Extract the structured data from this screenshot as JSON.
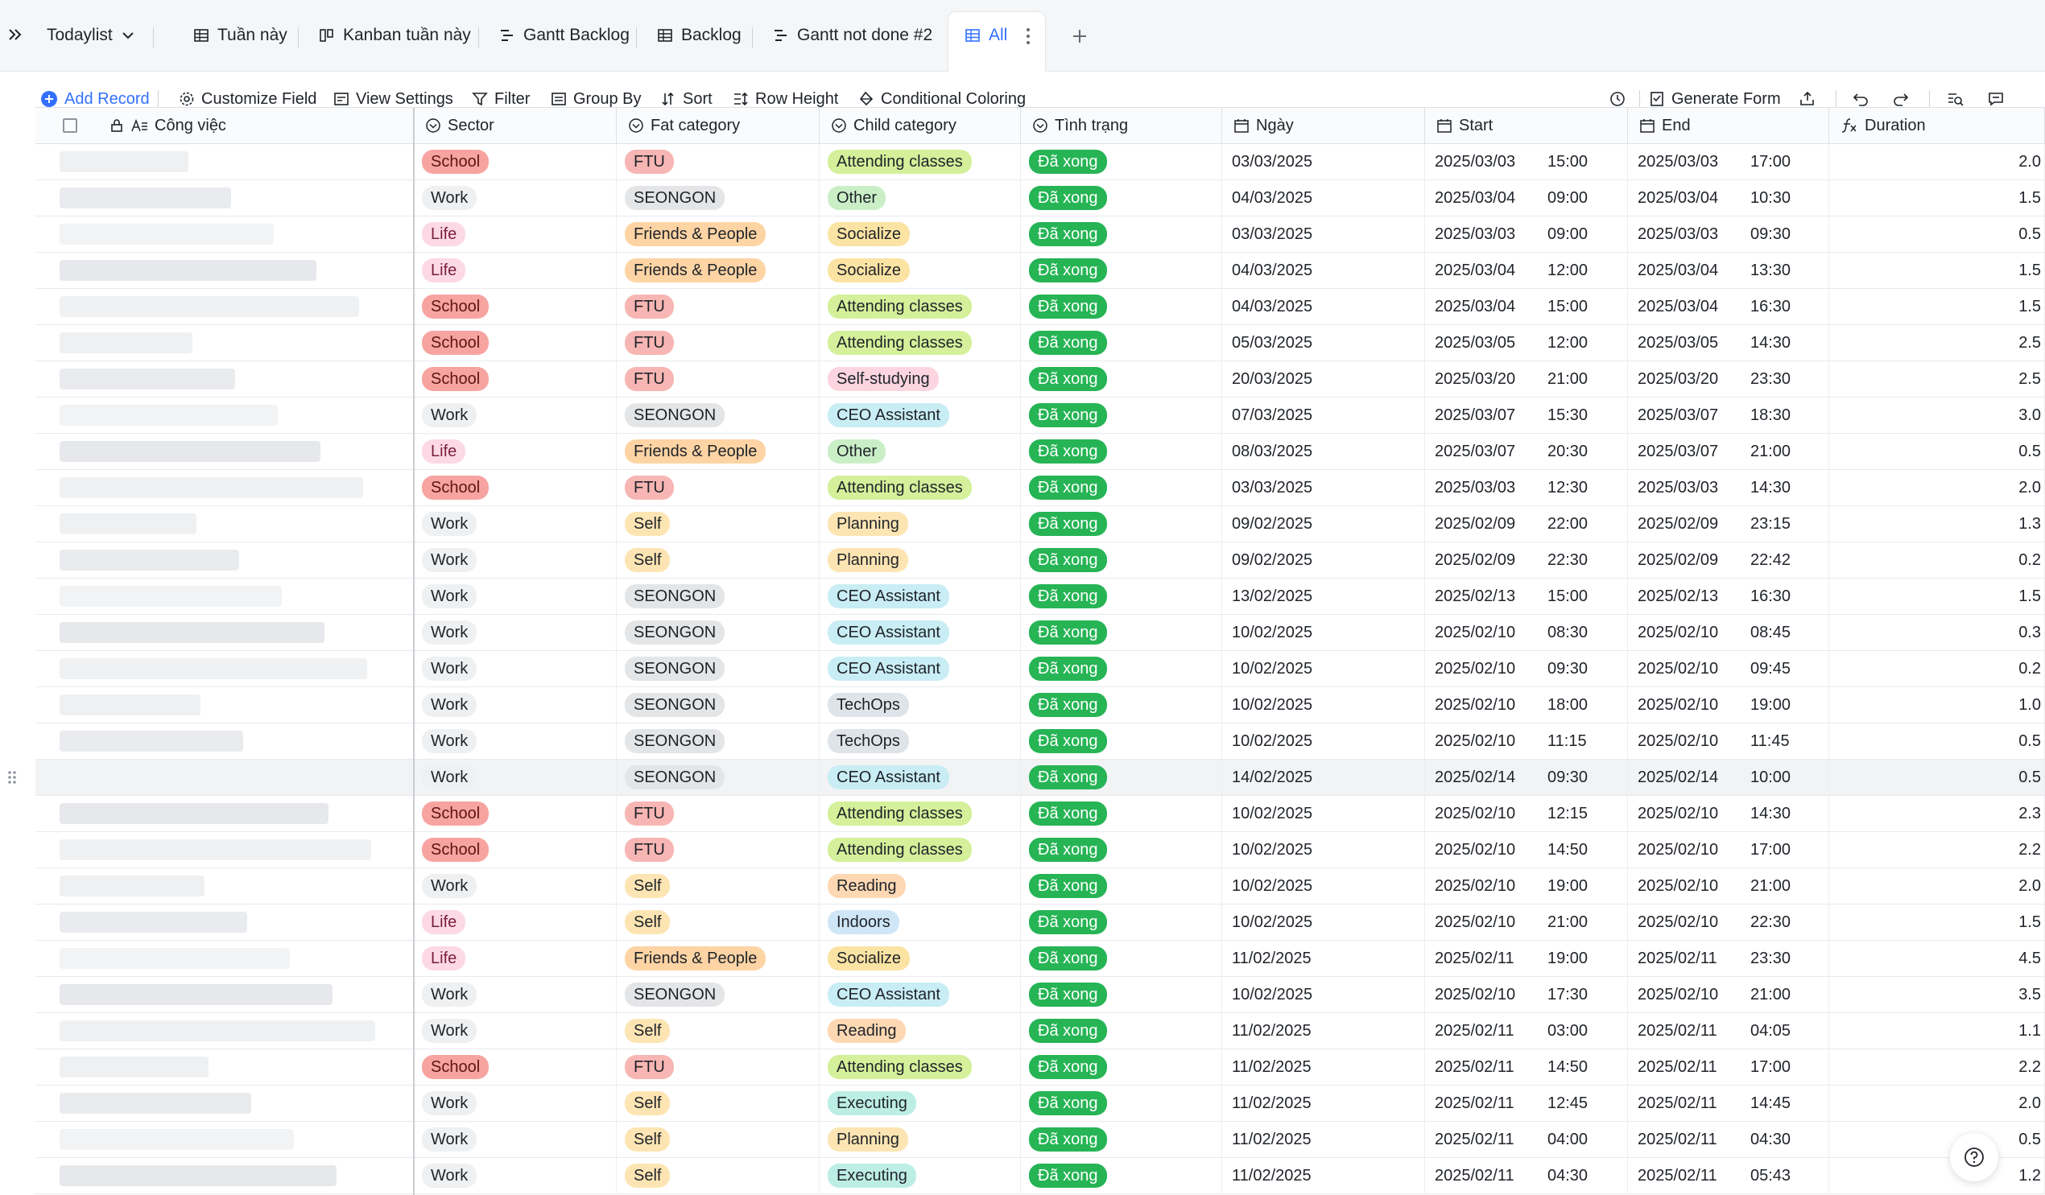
{
  "tabbar": {
    "base_name": "Todaylist",
    "tabs": [
      {
        "label": "Tuần này",
        "icon": "grid-icon"
      },
      {
        "label": "Kanban tuần này",
        "icon": "kanban-icon"
      },
      {
        "label": "Gantt Backlog",
        "icon": "gantt-icon"
      },
      {
        "label": "Backlog",
        "icon": "grid-icon"
      },
      {
        "label": "Gantt not done #2",
        "icon": "gantt-icon"
      },
      {
        "label": "All",
        "icon": "grid-icon",
        "active": true
      }
    ]
  },
  "toolbar": {
    "add_record": "Add Record",
    "customize_field": "Customize Field",
    "view_settings": "View Settings",
    "filter": "Filter",
    "group_by": "Group By",
    "sort": "Sort",
    "row_height": "Row Height",
    "conditional_coloring": "Conditional Coloring",
    "generate_form": "Generate Form"
  },
  "columns": {
    "name": "Công việc",
    "sector": "Sector",
    "fat": "Fat category",
    "child": "Child category",
    "status": "Tình trạng",
    "date": "Ngày",
    "start": "Start",
    "end": "End",
    "duration": "Duration"
  },
  "colors": {
    "accent": "#3370ff",
    "school_bg": "#f7a4a1",
    "school_fg": "#5c1511",
    "work_bg": "#eff0f1",
    "work_fg": "#1f2329",
    "life_bg": "#fcd9e4",
    "life_fg": "#7a1e3e",
    "ftu_bg": "#f7b6b3",
    "seongon_bg": "#e4e5e7",
    "friends_bg": "#fed4a4",
    "self_bg": "#fde5b3",
    "attending_bg": "#d4f09a",
    "other_bg": "#caefc7",
    "socialize_bg": "#fbe3a3",
    "selfstudy_bg": "#fcd5e0",
    "ceo_bg": "#c9edf4",
    "planning_bg": "#fde5b3",
    "techops_bg": "#dfe4ea",
    "reading_bg": "#fdd8b3",
    "indoors_bg": "#cfe6f7",
    "executing_bg": "#bdeee6",
    "status_bg": "#26b455"
  },
  "rows": [
    {
      "sector": "School",
      "fat": "FTU",
      "child": "Attending classes",
      "status": "Đã xong",
      "date": "03/03/2025",
      "start_d": "2025/03/03",
      "start_t": "15:00",
      "end_d": "2025/03/03",
      "end_t": "17:00",
      "dur": "2.0"
    },
    {
      "sector": "Work",
      "fat": "SEONGON",
      "child": "Other",
      "status": "Đã xong",
      "date": "04/03/2025",
      "start_d": "2025/03/04",
      "start_t": "09:00",
      "end_d": "2025/03/04",
      "end_t": "10:30",
      "dur": "1.5"
    },
    {
      "sector": "Life",
      "fat": "Friends & People",
      "child": "Socialize",
      "status": "Đã xong",
      "date": "03/03/2025",
      "start_d": "2025/03/03",
      "start_t": "09:00",
      "end_d": "2025/03/03",
      "end_t": "09:30",
      "dur": "0.5"
    },
    {
      "sector": "Life",
      "fat": "Friends & People",
      "child": "Socialize",
      "status": "Đã xong",
      "date": "04/03/2025",
      "start_d": "2025/03/04",
      "start_t": "12:00",
      "end_d": "2025/03/04",
      "end_t": "13:30",
      "dur": "1.5"
    },
    {
      "sector": "School",
      "fat": "FTU",
      "child": "Attending classes",
      "status": "Đã xong",
      "date": "04/03/2025",
      "start_d": "2025/03/04",
      "start_t": "15:00",
      "end_d": "2025/03/04",
      "end_t": "16:30",
      "dur": "1.5"
    },
    {
      "sector": "School",
      "fat": "FTU",
      "child": "Attending classes",
      "status": "Đã xong",
      "date": "05/03/2025",
      "start_d": "2025/03/05",
      "start_t": "12:00",
      "end_d": "2025/03/05",
      "end_t": "14:30",
      "dur": "2.5"
    },
    {
      "sector": "School",
      "fat": "FTU",
      "child": "Self-studying",
      "status": "Đã xong",
      "date": "20/03/2025",
      "start_d": "2025/03/20",
      "start_t": "21:00",
      "end_d": "2025/03/20",
      "end_t": "23:30",
      "dur": "2.5"
    },
    {
      "sector": "Work",
      "fat": "SEONGON",
      "child": "CEO Assistant",
      "status": "Đã xong",
      "date": "07/03/2025",
      "start_d": "2025/03/07",
      "start_t": "15:30",
      "end_d": "2025/03/07",
      "end_t": "18:30",
      "dur": "3.0"
    },
    {
      "sector": "Life",
      "fat": "Friends & People",
      "child": "Other",
      "status": "Đã xong",
      "date": "08/03/2025",
      "start_d": "2025/03/07",
      "start_t": "20:30",
      "end_d": "2025/03/07",
      "end_t": "21:00",
      "dur": "0.5"
    },
    {
      "sector": "School",
      "fat": "FTU",
      "child": "Attending classes",
      "status": "Đã xong",
      "date": "03/03/2025",
      "start_d": "2025/03/03",
      "start_t": "12:30",
      "end_d": "2025/03/03",
      "end_t": "14:30",
      "dur": "2.0"
    },
    {
      "sector": "Work",
      "fat": "Self",
      "child": "Planning",
      "status": "Đã xong",
      "date": "09/02/2025",
      "start_d": "2025/02/09",
      "start_t": "22:00",
      "end_d": "2025/02/09",
      "end_t": "23:15",
      "dur": "1.3"
    },
    {
      "sector": "Work",
      "fat": "Self",
      "child": "Planning",
      "status": "Đã xong",
      "date": "09/02/2025",
      "start_d": "2025/02/09",
      "start_t": "22:30",
      "end_d": "2025/02/09",
      "end_t": "22:42",
      "dur": "0.2"
    },
    {
      "sector": "Work",
      "fat": "SEONGON",
      "child": "CEO Assistant",
      "status": "Đã xong",
      "date": "13/02/2025",
      "start_d": "2025/02/13",
      "start_t": "15:00",
      "end_d": "2025/02/13",
      "end_t": "16:30",
      "dur": "1.5"
    },
    {
      "sector": "Work",
      "fat": "SEONGON",
      "child": "CEO Assistant",
      "status": "Đã xong",
      "date": "10/02/2025",
      "start_d": "2025/02/10",
      "start_t": "08:30",
      "end_d": "2025/02/10",
      "end_t": "08:45",
      "dur": "0.3"
    },
    {
      "sector": "Work",
      "fat": "SEONGON",
      "child": "CEO Assistant",
      "status": "Đã xong",
      "date": "10/02/2025",
      "start_d": "2025/02/10",
      "start_t": "09:30",
      "end_d": "2025/02/10",
      "end_t": "09:45",
      "dur": "0.2"
    },
    {
      "sector": "Work",
      "fat": "SEONGON",
      "child": "TechOps",
      "status": "Đã xong",
      "date": "10/02/2025",
      "start_d": "2025/02/10",
      "start_t": "18:00",
      "end_d": "2025/02/10",
      "end_t": "19:00",
      "dur": "1.0"
    },
    {
      "sector": "Work",
      "fat": "SEONGON",
      "child": "TechOps",
      "status": "Đã xong",
      "date": "10/02/2025",
      "start_d": "2025/02/10",
      "start_t": "11:15",
      "end_d": "2025/02/10",
      "end_t": "11:45",
      "dur": "0.5"
    },
    {
      "sector": "Work",
      "fat": "SEONGON",
      "child": "CEO Assistant",
      "status": "Đã xong",
      "date": "14/02/2025",
      "start_d": "2025/02/14",
      "start_t": "09:30",
      "end_d": "2025/02/14",
      "end_t": "10:00",
      "dur": "0.5",
      "highlight": true
    },
    {
      "sector": "School",
      "fat": "FTU",
      "child": "Attending classes",
      "status": "Đã xong",
      "date": "10/02/2025",
      "start_d": "2025/02/10",
      "start_t": "12:15",
      "end_d": "2025/02/10",
      "end_t": "14:30",
      "dur": "2.3"
    },
    {
      "sector": "School",
      "fat": "FTU",
      "child": "Attending classes",
      "status": "Đã xong",
      "date": "10/02/2025",
      "start_d": "2025/02/10",
      "start_t": "14:50",
      "end_d": "2025/02/10",
      "end_t": "17:00",
      "dur": "2.2"
    },
    {
      "sector": "Work",
      "fat": "Self",
      "child": "Reading",
      "status": "Đã xong",
      "date": "10/02/2025",
      "start_d": "2025/02/10",
      "start_t": "19:00",
      "end_d": "2025/02/10",
      "end_t": "21:00",
      "dur": "2.0"
    },
    {
      "sector": "Life",
      "fat": "Self",
      "child": "Indoors",
      "status": "Đã xong",
      "date": "10/02/2025",
      "start_d": "2025/02/10",
      "start_t": "21:00",
      "end_d": "2025/02/10",
      "end_t": "22:30",
      "dur": "1.5"
    },
    {
      "sector": "Life",
      "fat": "Friends & People",
      "child": "Socialize",
      "status": "Đã xong",
      "date": "11/02/2025",
      "start_d": "2025/02/11",
      "start_t": "19:00",
      "end_d": "2025/02/11",
      "end_t": "23:30",
      "dur": "4.5"
    },
    {
      "sector": "Work",
      "fat": "SEONGON",
      "child": "CEO Assistant",
      "status": "Đã xong",
      "date": "10/02/2025",
      "start_d": "2025/02/10",
      "start_t": "17:30",
      "end_d": "2025/02/10",
      "end_t": "21:00",
      "dur": "3.5"
    },
    {
      "sector": "Work",
      "fat": "Self",
      "child": "Reading",
      "status": "Đã xong",
      "date": "11/02/2025",
      "start_d": "2025/02/11",
      "start_t": "03:00",
      "end_d": "2025/02/11",
      "end_t": "04:05",
      "dur": "1.1"
    },
    {
      "sector": "School",
      "fat": "FTU",
      "child": "Attending classes",
      "status": "Đã xong",
      "date": "11/02/2025",
      "start_d": "2025/02/11",
      "start_t": "14:50",
      "end_d": "2025/02/11",
      "end_t": "17:00",
      "dur": "2.2"
    },
    {
      "sector": "Work",
      "fat": "Self",
      "child": "Executing",
      "status": "Đã xong",
      "date": "11/02/2025",
      "start_d": "2025/02/11",
      "start_t": "12:45",
      "end_d": "2025/02/11",
      "end_t": "14:45",
      "dur": "2.0"
    },
    {
      "sector": "Work",
      "fat": "Self",
      "child": "Planning",
      "status": "Đã xong",
      "date": "11/02/2025",
      "start_d": "2025/02/11",
      "start_t": "04:00",
      "end_d": "2025/02/11",
      "end_t": "04:30",
      "dur": "0.5"
    },
    {
      "sector": "Work",
      "fat": "Self",
      "child": "Executing",
      "status": "Đã xong",
      "date": "11/02/2025",
      "start_d": "2025/02/11",
      "start_t": "04:30",
      "end_d": "2025/02/11",
      "end_t": "05:43",
      "dur": "1.2"
    }
  ]
}
